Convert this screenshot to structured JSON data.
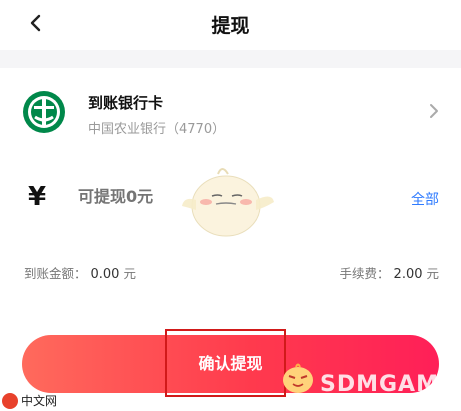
{
  "header": {
    "title": "提现"
  },
  "bank": {
    "title": "到账银行卡",
    "subtitle": "中国农业银行（4770）",
    "logo_icon": "abc-bank-logo-icon"
  },
  "amount": {
    "currency_symbol": "¥",
    "placeholder": "可提现0元",
    "all_label": "全部"
  },
  "fees": {
    "received_label": "到账金额：",
    "received_value": "0.00",
    "received_unit": "元",
    "fee_label": "手续费：",
    "fee_value": "2.00",
    "fee_unit": "元"
  },
  "confirm": {
    "label": "确认提现"
  },
  "watermark": {
    "left_text": "中文网",
    "right_text": "SDMGAME"
  },
  "colors": {
    "accent_blue": "#2f7bff",
    "button_gradient_start": "#ff6a5c",
    "button_gradient_end": "#ff1f58",
    "bank_green": "#00884a"
  }
}
